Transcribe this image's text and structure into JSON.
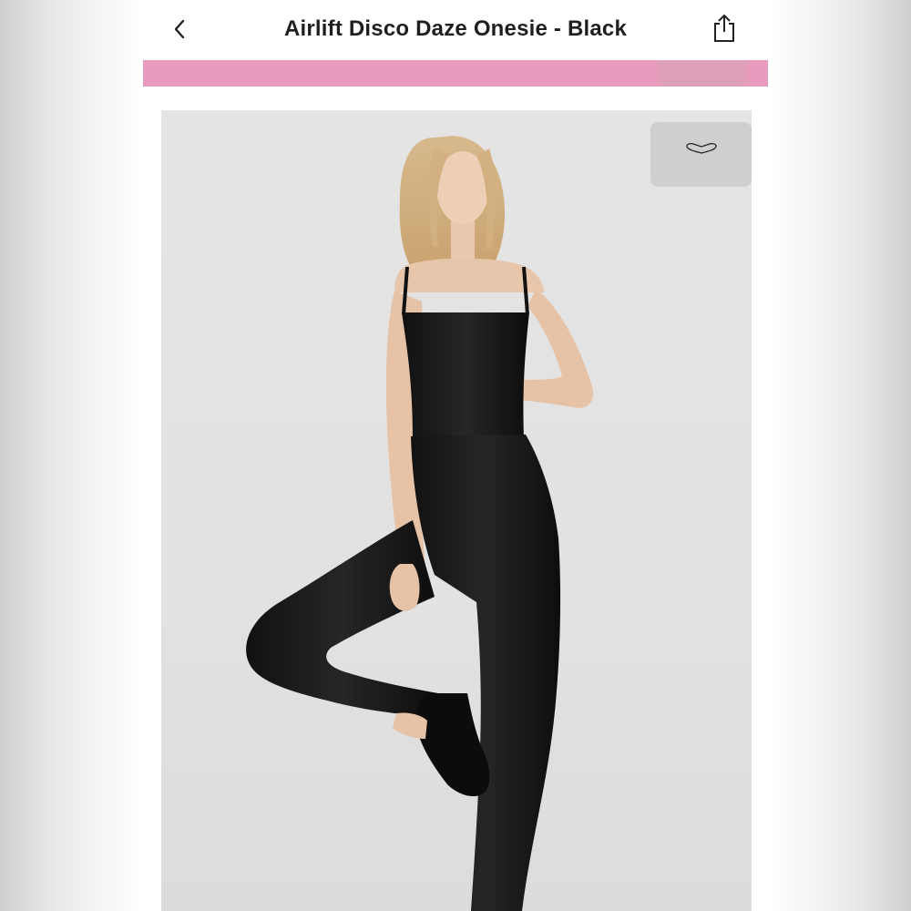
{
  "header": {
    "title": "Airlift Disco Daze Onesie - Black",
    "back_icon": "chevron-left-icon",
    "share_icon": "share-icon"
  },
  "banner": {
    "color": "#e89cbd"
  },
  "product_image": {
    "background": "#e3e3e3",
    "like_icon": "heart-outline-icon"
  }
}
